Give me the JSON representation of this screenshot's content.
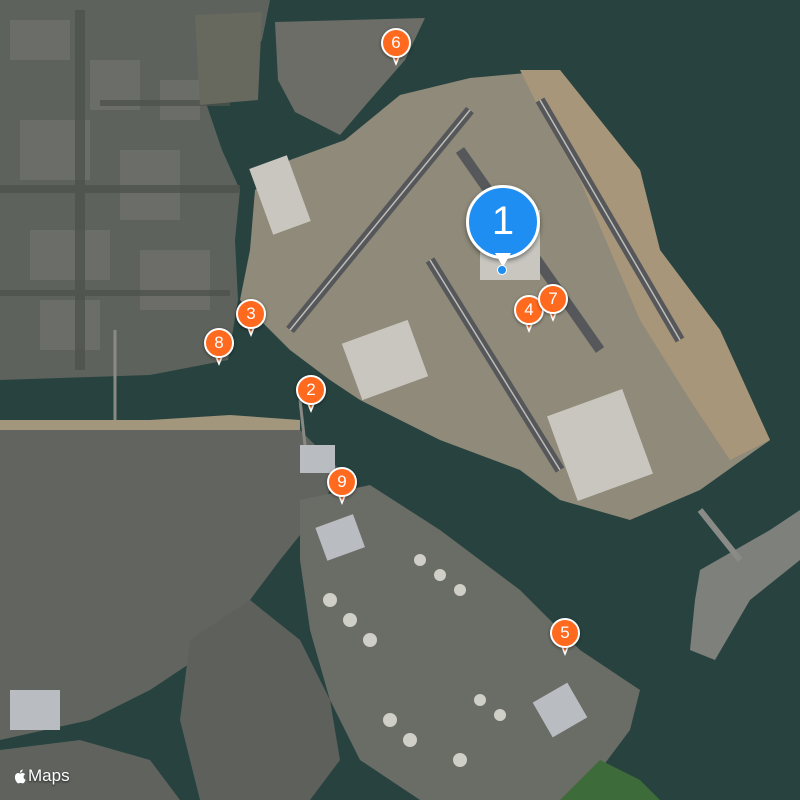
{
  "map": {
    "type": "satellite",
    "pins": [
      {
        "label": "1",
        "style": "large",
        "color": "#1e8ef2"
      },
      {
        "label": "2",
        "style": "small",
        "color": "#ff6a1f"
      },
      {
        "label": "3",
        "style": "small",
        "color": "#ff6a1f"
      },
      {
        "label": "4",
        "style": "small",
        "color": "#ff6a1f"
      },
      {
        "label": "5",
        "style": "small",
        "color": "#ff6a1f"
      },
      {
        "label": "6",
        "style": "small",
        "color": "#ff6a1f"
      },
      {
        "label": "7",
        "style": "small",
        "color": "#ff6a1f"
      },
      {
        "label": "8",
        "style": "small",
        "color": "#ff6a1f"
      },
      {
        "label": "9",
        "style": "small",
        "color": "#ff6a1f"
      }
    ]
  },
  "attribution": {
    "icon": "apple-logo-icon",
    "text": "Maps"
  }
}
